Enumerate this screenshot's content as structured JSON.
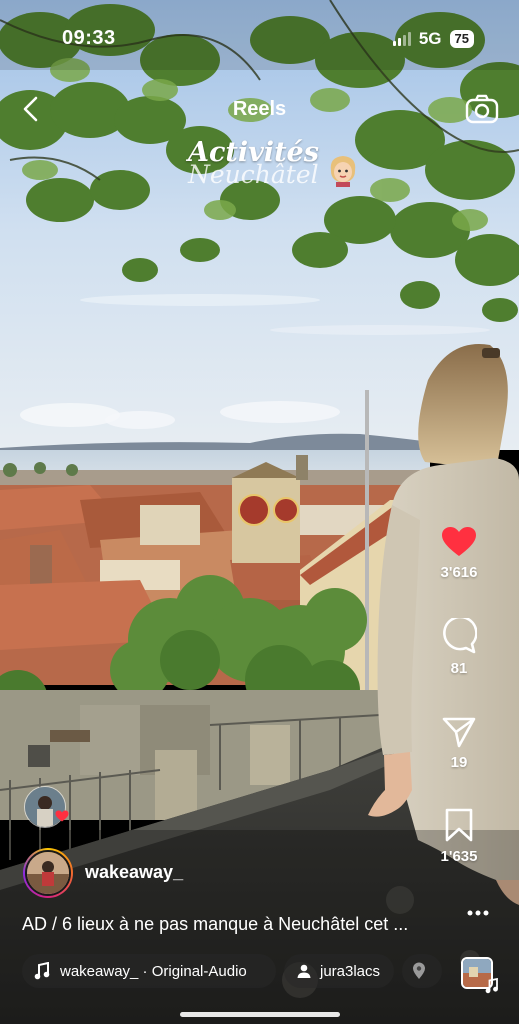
{
  "status_bar": {
    "time": "09:33",
    "network": "5G",
    "battery": "75"
  },
  "header": {
    "title": "Reels"
  },
  "sticker": {
    "title": "Activités",
    "subtitle": "Neuchâtel"
  },
  "actions": {
    "likes": "3'616",
    "comments": "81",
    "shares": "19",
    "saves": "1'635"
  },
  "author": {
    "username": "wakeaway_"
  },
  "caption": "AD / 6 lieux à ne pas manque à Neuchâtel cet ...",
  "chips": {
    "audio": "wakeaway_ · Original-Audio",
    "tagged_user": "jura3lacs"
  },
  "colors": {
    "like_red": "#ff3040",
    "sky_top": "#b9d3ee",
    "lake": "#cfdbe6"
  },
  "icons": [
    "back-icon",
    "camera-icon",
    "heart-icon",
    "comment-icon",
    "share-icon",
    "bookmark-icon",
    "more-icon",
    "music-icon",
    "person-icon",
    "location-icon"
  ]
}
